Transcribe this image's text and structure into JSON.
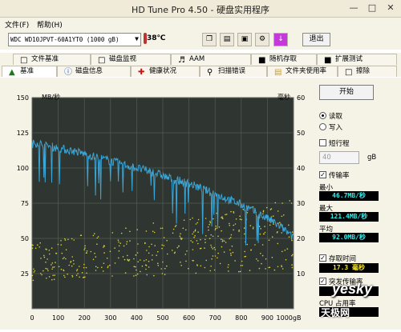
{
  "window": {
    "title": "HD Tune Pro 4.50 - 硬盘实用程序"
  },
  "menu": {
    "file": "文件(F)",
    "help": "帮助(H)"
  },
  "toolbar": {
    "drive": "WDC WD10JPVT-60A1YT0 (1000 gB)",
    "temperature": "38℃",
    "exit_label": "退出",
    "buttons": [
      "copy-info",
      "copy-screen",
      "save",
      "options",
      "download"
    ]
  },
  "tabs_row1": [
    {
      "label": "文件基准",
      "icon": "file-benchmark-icon"
    },
    {
      "label": "磁盘监视",
      "icon": "disk-monitor-icon"
    },
    {
      "label": "AAM",
      "icon": "speaker-icon"
    },
    {
      "label": "随机存取",
      "icon": "random-access-icon"
    },
    {
      "label": "扩展测试",
      "icon": "extra-tests-icon"
    }
  ],
  "tabs_row2": [
    {
      "label": "基准",
      "icon": "benchmark-icon"
    },
    {
      "label": "磁盘信息",
      "icon": "info-icon"
    },
    {
      "label": "健康状况",
      "icon": "health-icon"
    },
    {
      "label": "扫描错误",
      "icon": "scan-icon"
    },
    {
      "label": "文件夹使用率",
      "icon": "folder-icon"
    },
    {
      "label": "擦除",
      "icon": "erase-icon"
    }
  ],
  "side": {
    "start_label": "开始",
    "read_label": "读取",
    "write_label": "写入",
    "short_stroke_label": "短行程",
    "short_stroke_value": "40",
    "short_stroke_unit": "gB",
    "transfer_rate_label": "传输率",
    "min_label": "最小",
    "min_value": "46.7MB/秒",
    "max_label": "最大",
    "max_value": "121.4MB/秒",
    "avg_label": "平均",
    "avg_value": "92.0MB/秒",
    "access_time_label": "存取时间",
    "access_time_value": "17.3 毫秒",
    "burst_label": "突发传输率",
    "cpu_label": "CPU 占用率",
    "read_selected": true,
    "short_stroke_checked": false,
    "transfer_checked": true,
    "access_checked": true,
    "burst_checked": true
  },
  "watermark": {
    "text1": "yesky",
    "text2": "天极网"
  },
  "colors": {
    "transfer_line": "#3aa6d8",
    "access_dots": "#d8d040",
    "grid": "#555e55",
    "plot_bg": "#2f3530"
  },
  "chart_data": {
    "type": "line",
    "y_left_label": "MB/秒",
    "y_right_label": "毫秒",
    "x_unit": "gB",
    "ylim_left": [
      0,
      150
    ],
    "ylim_right": [
      0,
      60
    ],
    "xlim": [
      0,
      1000
    ],
    "x_ticks": [
      0,
      100,
      200,
      300,
      400,
      500,
      600,
      700,
      800,
      900,
      1000
    ],
    "y_left_ticks": [
      25,
      50,
      75,
      100,
      125,
      150
    ],
    "y_right_ticks": [
      10,
      20,
      30,
      40,
      50,
      60
    ],
    "series": [
      {
        "name": "传输率",
        "x": [
          0,
          20,
          50,
          80,
          100,
          130,
          160,
          200,
          240,
          280,
          320,
          360,
          400,
          440,
          480,
          520,
          560,
          600,
          640,
          680,
          720,
          760,
          800,
          840,
          880,
          920,
          960,
          1000
        ],
        "y": [
          117,
          118,
          116,
          115,
          114,
          113,
          112,
          110,
          108,
          106,
          104,
          102,
          100,
          98,
          96,
          93,
          91,
          89,
          86,
          83,
          80,
          77,
          74,
          70,
          66,
          62,
          57,
          50
        ]
      }
    ],
    "access_time_dots_range_ms": [
      8,
      28
    ]
  }
}
